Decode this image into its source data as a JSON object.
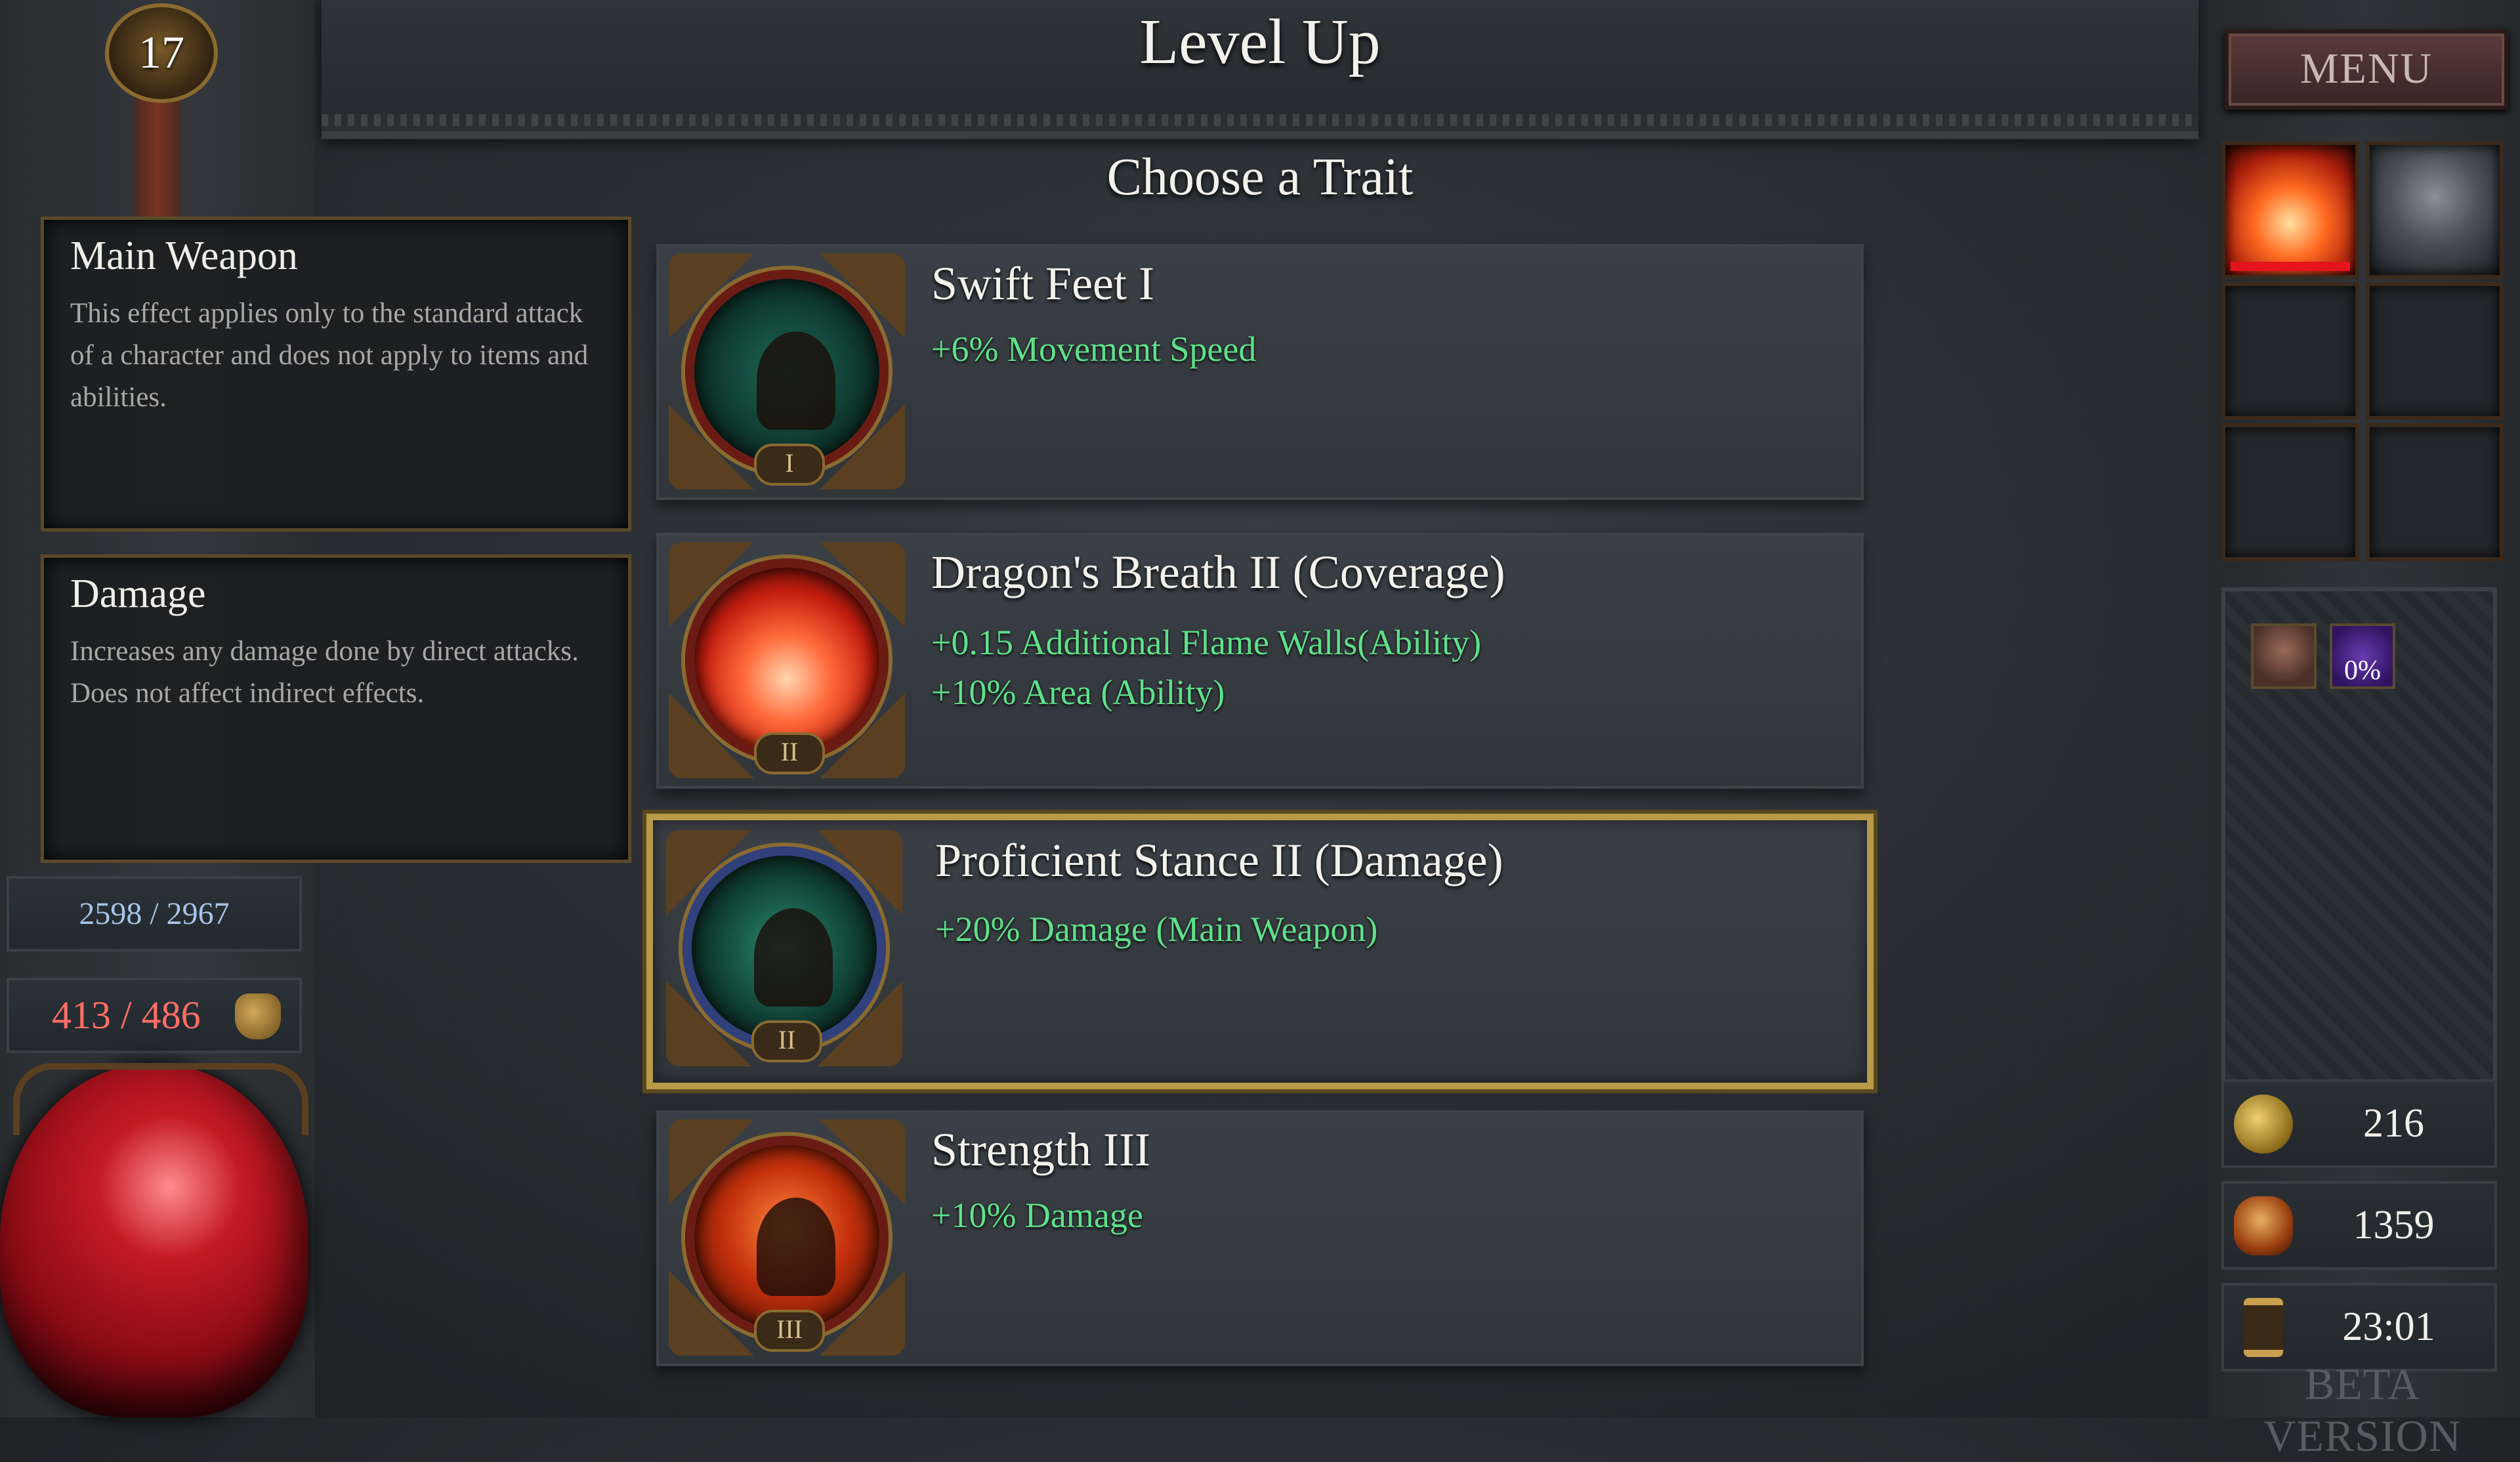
{
  "header": {
    "title": "Level Up",
    "subtitle": "Choose a Trait"
  },
  "player": {
    "level": "17",
    "mana": "2598 / 2967",
    "health": "413 / 486"
  },
  "tooltips": [
    {
      "title": "Main Weapon",
      "body": "This effect applies only to the standard attack of a character and does not apply to items and abilities."
    },
    {
      "title": "Damage",
      "body": "Increases any damage done by direct attacks. Does not affect indirect effects."
    }
  ],
  "traits": [
    {
      "name": "Swift Feet I",
      "roman": "I",
      "icon": "running-figure-icon",
      "effects": [
        "+6% Movement Speed"
      ]
    },
    {
      "name": "Dragon's Breath II (Coverage)",
      "roman": "II",
      "icon": "fire-icon",
      "effects": [
        "+0.15 Additional Flame Walls(Ability)",
        "+10% Area (Ability)"
      ]
    },
    {
      "name": "Proficient Stance II (Damage)",
      "roman": "II",
      "icon": "stance-figure-icon",
      "effects": [
        "+20% Damage (Main Weapon)"
      ],
      "selected": true
    },
    {
      "name": "Strength III",
      "roman": "III",
      "icon": "strength-figure-icon",
      "effects": [
        "+10% Damage"
      ]
    }
  ],
  "sidebar_right": {
    "menu_label": "MENU",
    "buff_percent": "0%",
    "gold": "216",
    "kills": "1359",
    "time": "23:01"
  },
  "footer": {
    "beta_label": "BETA VERSION"
  },
  "colors": {
    "effect_text": "#5fe08a",
    "selected_border": "#b89a48",
    "health_text": "#ff6e66",
    "mana_text": "#a8c4e8"
  }
}
